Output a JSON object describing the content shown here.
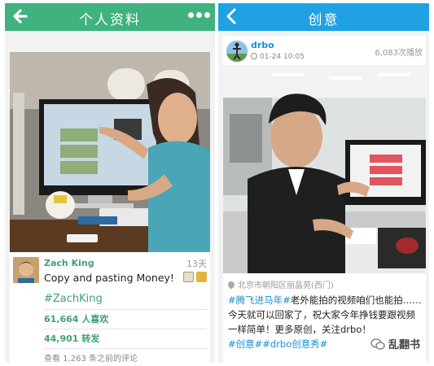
{
  "left_screen": {
    "header": {
      "title": "个人资料",
      "accent_color": "#3fb27f"
    },
    "post": {
      "username": "Zach King",
      "age": "13天",
      "caption": "Copy and pasting Money!",
      "hashtag": "#ZachKing",
      "likes": "61,664 人喜欢",
      "shares": "44,901 转发",
      "comments_link": "查看 1,263 条之前的评论"
    }
  },
  "right_screen": {
    "header": {
      "title": "创意",
      "accent_color": "#1fa1e3"
    },
    "post": {
      "username": "drbo",
      "date": "01-24 10:05",
      "plays": "6,083次播放",
      "location": "北京市朝阳区丽晶苑(西门)",
      "body_hashtag_1": "#腾飞进马年#",
      "body_text": "老外能拍的视频咱们也能拍……今天就可以回家了，祝大家今年挣钱要跟视频一样简单！更多原创，关注drbo！",
      "body_hashtag_2": "#创意##drbo创意秀#"
    }
  },
  "watermark": {
    "text": "乱翻书"
  },
  "icons": [
    "back-arrow-icon",
    "more-dots-icon",
    "back-chevron-icon",
    "clock-icon",
    "location-pin-icon",
    "emoji-icon",
    "wechat-icon"
  ]
}
